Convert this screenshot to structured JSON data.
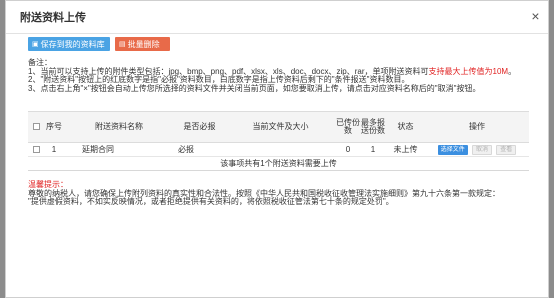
{
  "dialog": {
    "title": "附送资料上传",
    "close_label": "×"
  },
  "toolbar": {
    "save_label": "保存到我的资料库",
    "delete_label": "批量删除"
  },
  "notes": {
    "heading": "备注：",
    "line1_pre": "1、当前可以支持上传的附件类型包括：jpg、bmp、png、pdf、xlsx、xls、doc、docx、zip、rar，单项附送资料可",
    "line1_red": "支持最大上传值为10M",
    "line1_post": "。",
    "line2": "2、\"附送资料\"按钮上的红底数字是指\"必报\"资料数目，白底数字是指上传资料后剩下的\"条件报送\"资料数目。",
    "line3": "3、点击右上角\"×\"按钮会自动上传您所选择的资料文件并关闭当前页面，如您要取消上传，请点击对应资料名称后的\"取消\"按钮。"
  },
  "table": {
    "headers": [
      "序号",
      "附送资料名称",
      "是否必报",
      "当前文件及大小",
      "已传份数",
      "最多报送份数",
      "状态",
      "操作"
    ],
    "rows": [
      {
        "index": "1",
        "name": "延期合同",
        "required": "必报",
        "file": "",
        "uploaded": "0",
        "max": "1",
        "status": "未上传",
        "actions": [
          "选择文件",
          "取消",
          "查看"
        ]
      }
    ],
    "footer": "该事项共有1个附送资料需要上传"
  },
  "reminder": {
    "title": "温馨提示：",
    "line1": "尊敬的纳税人，请您确保上传附列资料的真实性和合法性。按照《中华人民共和国税收征收管理法实施细则》第九十六条第一款规定：",
    "line2": "\"提供虚假资料，不如实反映情况，或者拒绝提供有关资料的，将依照税收征管法第七十条的规定处罚\"。"
  }
}
